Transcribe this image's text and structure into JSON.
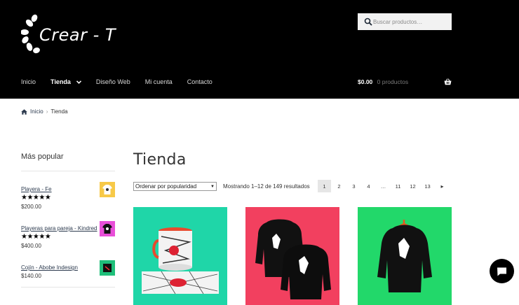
{
  "brand": {
    "name": "Crear - T"
  },
  "search": {
    "placeholder": "Buscar productos…"
  },
  "nav": {
    "items": [
      {
        "label": "Inicio"
      },
      {
        "label": "Tienda"
      },
      {
        "label": "Diseño Web"
      },
      {
        "label": "Mi cuenta"
      },
      {
        "label": "Contacto"
      }
    ]
  },
  "cart": {
    "amount": "$0.00",
    "count": "0 productos"
  },
  "breadcrumb": {
    "home": "Inicio",
    "current": "Tienda"
  },
  "sidebar": {
    "title": "Más popular",
    "items": [
      {
        "name": "Playera - Fe",
        "stars": "★★★★★",
        "price": "$200.00",
        "thumb_color": "#f7c948"
      },
      {
        "name": "Playeras para pareja - Kindred",
        "stars": "★★★★★",
        "price": "$400.00",
        "thumb_color": "#e84fd8"
      },
      {
        "name": "Cojín - Abobe Indesign",
        "stars": "",
        "price": "$140.00",
        "thumb_color": "#1fbf7a"
      }
    ]
  },
  "main": {
    "title": "Tienda",
    "sort": {
      "selected": "Ordenar por popularidad"
    },
    "results_text": "Mostrando 1–12 de 149 resultados",
    "pagination": [
      "1",
      "2",
      "3",
      "4",
      "…",
      "11",
      "12",
      "13",
      "▸"
    ],
    "products": [
      {
        "kind": "mug",
        "bg": "#1fd6a8"
      },
      {
        "kind": "hoodies",
        "bg": "#f2405f"
      },
      {
        "kind": "hoodie",
        "bg": "#22d86a"
      }
    ]
  },
  "colors": {
    "header_bg": "#000000",
    "accent": "#2d3b4f"
  }
}
